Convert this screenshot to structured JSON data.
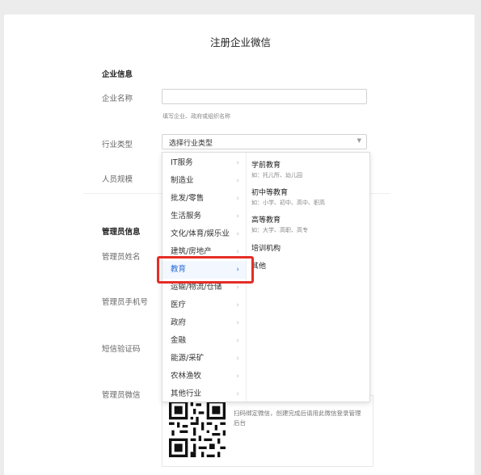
{
  "page": {
    "title": "注册企业微信"
  },
  "sections": {
    "company": "企业信息",
    "admin": "管理员信息"
  },
  "fields": {
    "company_name": {
      "label": "企业名称",
      "hint": "填写企业、政府或组织名称"
    },
    "industry": {
      "label": "行业类型",
      "selected": "选择行业类型"
    },
    "staff_size": {
      "label": "人员规模"
    },
    "admin_name": {
      "label": "管理员姓名"
    },
    "admin_phone": {
      "label": "管理员手机号"
    },
    "sms_code": {
      "label": "短信验证码"
    },
    "admin_wechat": {
      "label": "管理员微信",
      "qr_text": "扫码绑定微信，创建完成后请用此微信登录管理后台"
    }
  },
  "industry_menu": {
    "categories": [
      "IT服务",
      "制造业",
      "批发/零售",
      "生活服务",
      "文化/体育/娱乐业",
      "建筑/房地产",
      "教育",
      "运输/物流/仓储",
      "医疗",
      "政府",
      "金融",
      "能源/采矿",
      "农林渔牧",
      "其他行业"
    ],
    "active": "教育",
    "subcategories": [
      {
        "title": "学前教育",
        "desc": "如：托儿所、幼儿园"
      },
      {
        "title": "初中等教育",
        "desc": "如：小学、初中、高中、职高"
      },
      {
        "title": "高等教育",
        "desc": "如：大学、高职、高专"
      },
      {
        "title": "培训机构",
        "desc": ""
      },
      {
        "title": "其他",
        "desc": ""
      }
    ]
  },
  "colors": {
    "highlight": "#e52d27",
    "active": "#2b6fd6"
  }
}
